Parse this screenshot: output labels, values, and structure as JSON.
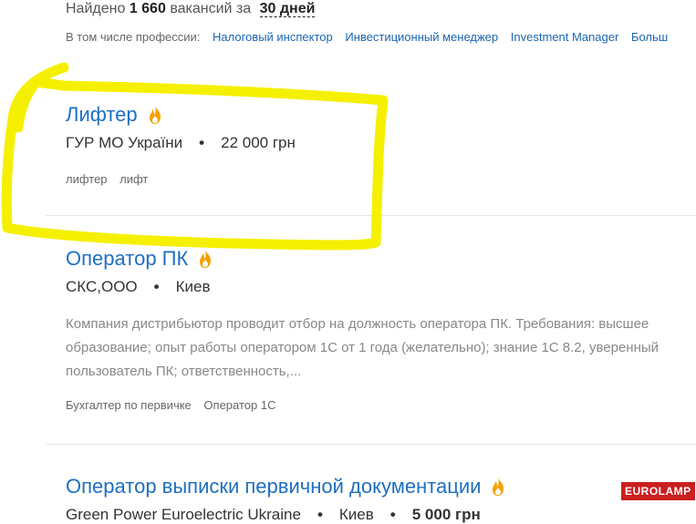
{
  "summary": {
    "found_prefix": "Найдено",
    "count": "1 660",
    "vacancies_for": "вакансий за",
    "period": "30 дней"
  },
  "professions": {
    "label": "В том числе профессии:",
    "items": [
      "Налоговый инспектор",
      "Инвестиционный менеджер",
      "Investment Manager",
      "Больш"
    ]
  },
  "vacancies": [
    {
      "title": "Лифтер",
      "company": "ГУР МО України",
      "salary": "22 000 грн",
      "tags": [
        "лифтер",
        "лифт"
      ]
    },
    {
      "title": "Оператор ПК",
      "company": "СКС,ООО",
      "city": "Киев",
      "description": "Компания дистрибьютор проводит отбор на должность оператора ПК. Требования: высшее образование; опыт работы оператором 1С от 1 года (желательно); знание 1С 8.2, уверенный пользователь ПК; ответственность,...",
      "tags": [
        "Бухгалтер по первичке",
        "Оператор 1С"
      ]
    },
    {
      "title": "Оператор выписки первичной документации",
      "company": "Green Power Euroelectric Ukraine",
      "city": "Киев",
      "salary": "5 000 грн",
      "logo_text": "EUROLAMP"
    }
  ],
  "colors": {
    "link": "#1f6fbf",
    "highlight": "#f5f000",
    "fire": "#f5a000",
    "logo_bg": "#cc1f1f"
  }
}
